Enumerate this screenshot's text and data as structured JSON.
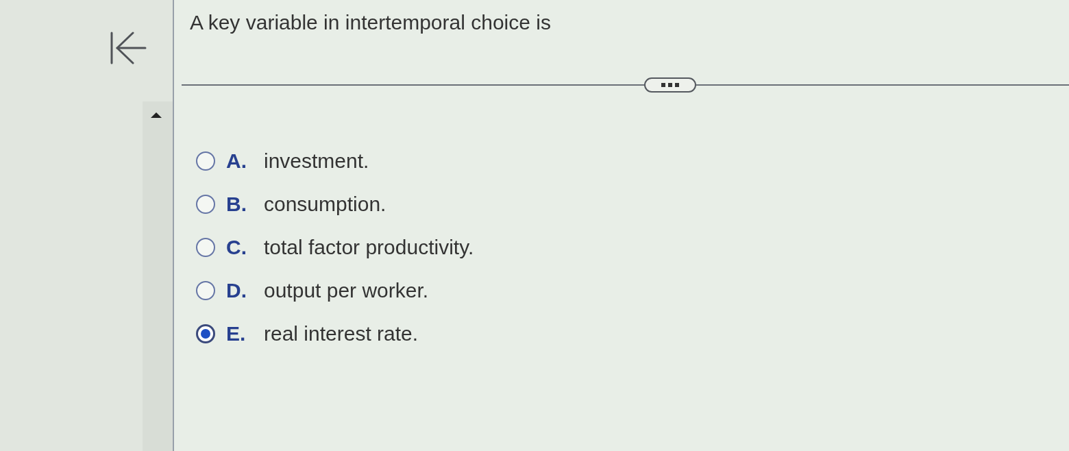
{
  "question": {
    "prompt": "A key variable in intertemporal choice is"
  },
  "options": [
    {
      "letter": "A.",
      "text": "investment.",
      "selected": false
    },
    {
      "letter": "B.",
      "text": "consumption.",
      "selected": false
    },
    {
      "letter": "C.",
      "text": "total factor productivity.",
      "selected": false
    },
    {
      "letter": "D.",
      "text": "output per worker.",
      "selected": false
    },
    {
      "letter": "E.",
      "text": "real interest rate.",
      "selected": true
    }
  ]
}
